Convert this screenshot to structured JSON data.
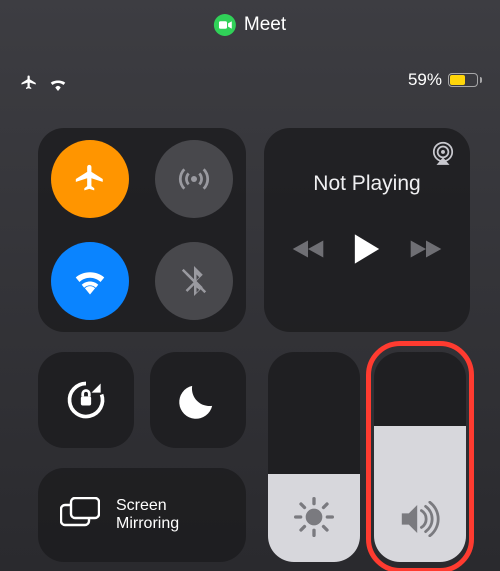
{
  "pill": {
    "app_name": "Meet"
  },
  "status": {
    "battery_pct_label": "59%",
    "battery_fill_pct": 59,
    "low_power": true
  },
  "connectivity": {
    "airplane": true,
    "cellular": false,
    "wifi": true,
    "bluetooth": false
  },
  "media": {
    "now_playing_label": "Not Playing"
  },
  "toggles": {
    "rotation_lock": true,
    "dnd": false
  },
  "screen_mirroring": {
    "label": "Screen\nMirroring"
  },
  "sliders": {
    "brightness_pct": 42,
    "volume_pct": 65
  },
  "annotation": {
    "highlight": "volume"
  }
}
